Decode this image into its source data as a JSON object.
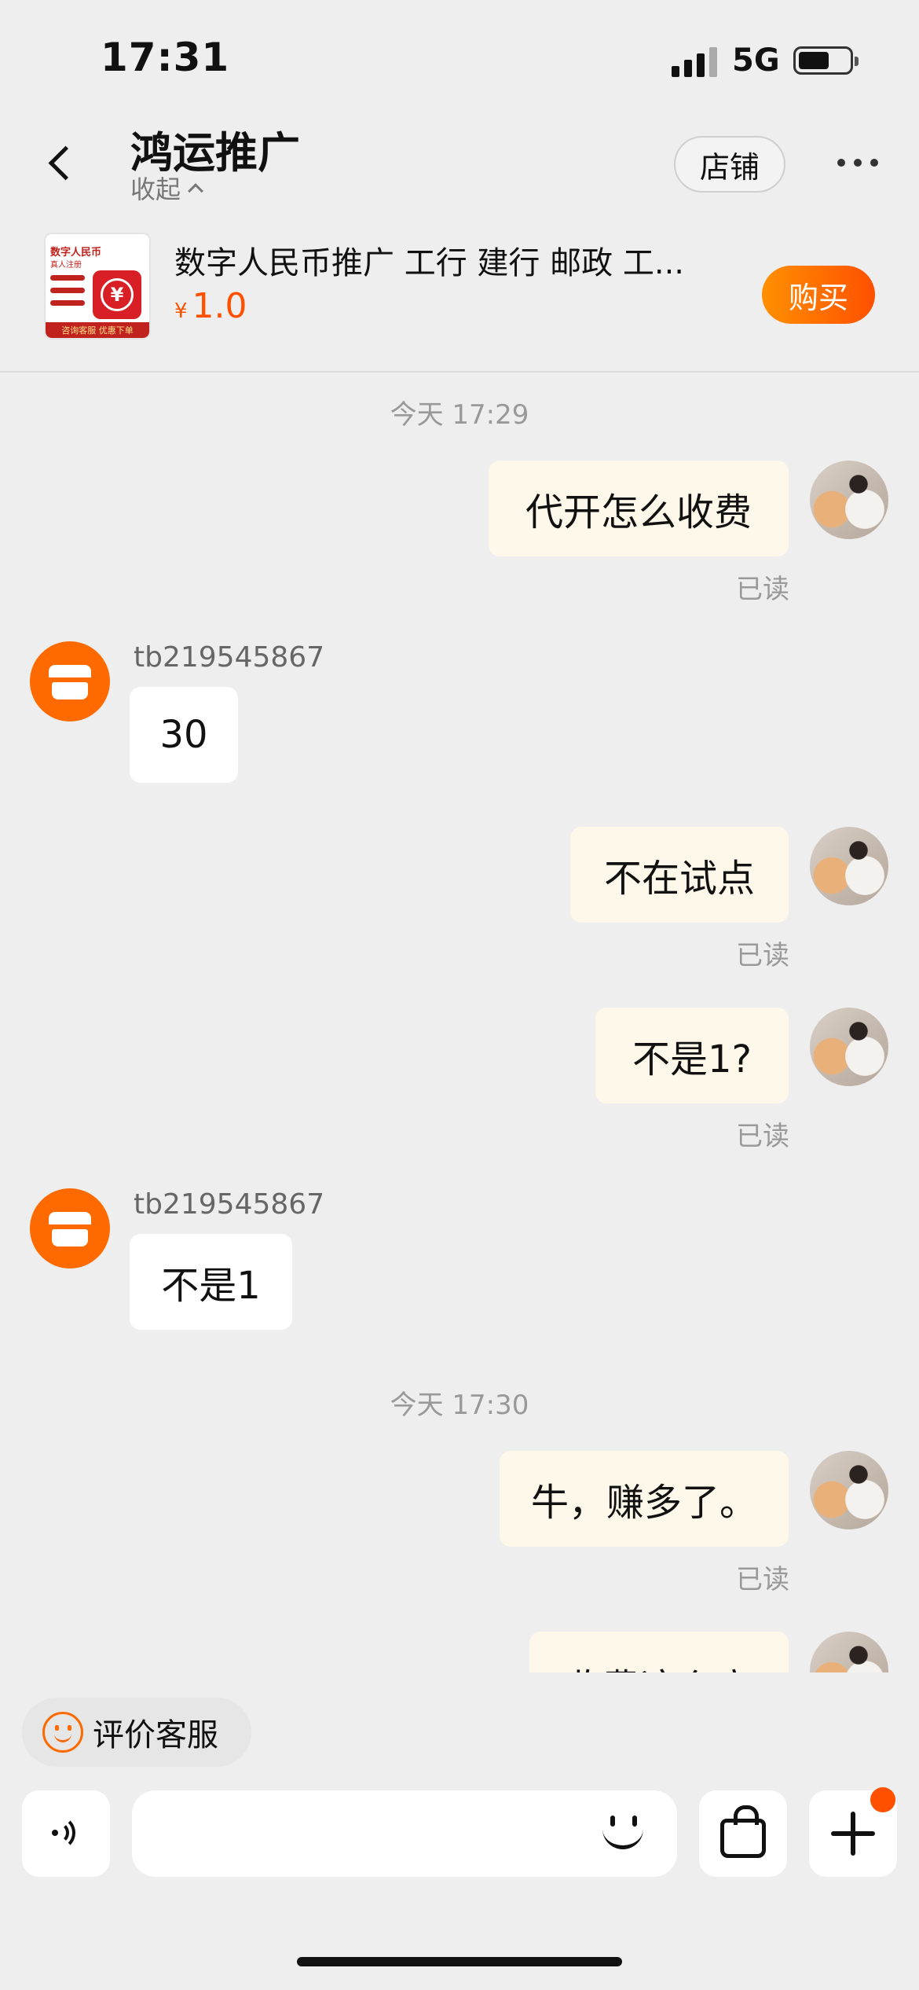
{
  "status_bar": {
    "time": "17:31",
    "network": "5G",
    "signal_icon": "signal-bars-icon",
    "battery_icon": "battery-icon"
  },
  "header": {
    "title": "鸿运推广",
    "collapse_label": "收起",
    "store_label": "店铺",
    "back_icon": "chevron-left-icon",
    "more_icon": "more-dots-icon"
  },
  "product": {
    "name": "数字人民币推广 工行 建行 邮政 工...",
    "currency": "¥",
    "price": "1.0",
    "buy_label": "购买",
    "image_title": "数字人民币",
    "image_subtitle": "真人注册",
    "image_footer": "咨询客服 优惠下单",
    "image_badge": "¥",
    "buy_colors": [
      "#ff9000",
      "#ff5000"
    ]
  },
  "messages": [
    {
      "type": "time",
      "text": "今天 17:29"
    },
    {
      "type": "out",
      "text": "代开怎么收费",
      "status": "已读"
    },
    {
      "type": "in",
      "sender": "tb219545867",
      "text": "30"
    },
    {
      "type": "out",
      "text": "不在试点",
      "status": "已读"
    },
    {
      "type": "out",
      "text": "不是1?",
      "status": "已读"
    },
    {
      "type": "in",
      "sender": "tb219545867",
      "text": "不是1"
    },
    {
      "type": "time",
      "text": "今天 17:30"
    },
    {
      "type": "out",
      "text": "牛，赚多了。",
      "status": "已读"
    },
    {
      "type": "out",
      "text": "收费这么高"
    }
  ],
  "bottom": {
    "rate_label": "评价客服",
    "rate_icon": "smiley-icon",
    "input_value": "",
    "icons": [
      "voice-icon",
      "emoji-icon",
      "shopping-bag-icon",
      "plus-icon"
    ]
  },
  "colors": {
    "accent": "#ff5000",
    "outgoing_bubble": "#fef8ea",
    "incoming_bubble": "#ffffff",
    "background": "#eeeeee"
  }
}
